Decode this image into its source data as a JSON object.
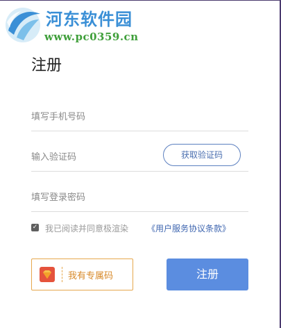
{
  "watermark": {
    "name": "河东软件园",
    "url": "www.pc0359.cn"
  },
  "title": "注册",
  "form": {
    "phone_placeholder": "填写手机号码",
    "code_placeholder": "输入验证码",
    "get_code_label": "获取验证码",
    "password_placeholder": "填写登录密码"
  },
  "agreement": {
    "checked": true,
    "text": "我已阅读并同意极渲染",
    "link": "《用户服务协议条款》"
  },
  "invite": {
    "label": "我有专属码"
  },
  "register_label": "注册",
  "colors": {
    "primary_button": "#5b8de0",
    "link": "#3f66b0",
    "invite_border": "#e6a74c",
    "invite_icon": "#e5533c"
  }
}
